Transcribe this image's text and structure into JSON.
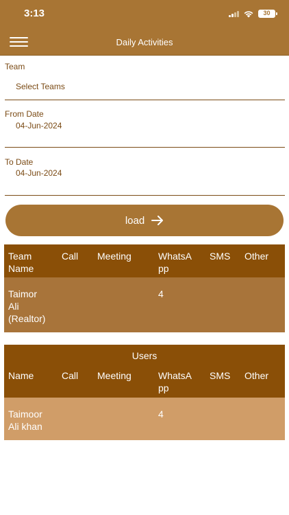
{
  "status": {
    "time": "3:13",
    "battery": "30"
  },
  "header": {
    "title": "Daily Activities"
  },
  "filters": {
    "team": {
      "label": "Team",
      "value": "Select Teams"
    },
    "from_date": {
      "label": "From Date",
      "value": "04-Jun-2024"
    },
    "to_date": {
      "label": "To Date",
      "value": "04-Jun-2024"
    }
  },
  "load_button": {
    "label": "load"
  },
  "team_table": {
    "columns": [
      "Team\nName",
      "Call",
      "Meeting",
      "WhatsA\npp",
      "SMS",
      "Other"
    ],
    "rows": [
      {
        "name": "Taimor\nAli\n(Realtor)",
        "call": "",
        "meeting": "",
        "whatsapp": "4",
        "sms": "",
        "other": ""
      }
    ],
    "row_color": "#a8743a"
  },
  "users_table": {
    "title": "Users",
    "columns": [
      "Name",
      "Call",
      "Meeting",
      "WhatsA\npp",
      "SMS",
      "Other"
    ],
    "rows": [
      {
        "name": "Taimoor\nAli khan",
        "call": "",
        "meeting": "",
        "whatsapp": "4",
        "sms": "",
        "other": ""
      }
    ],
    "row_color": "#d09d68"
  },
  "colors": {
    "primary": "#a87534",
    "header_dark": "#8a4f07",
    "text": "#7a4a14"
  }
}
